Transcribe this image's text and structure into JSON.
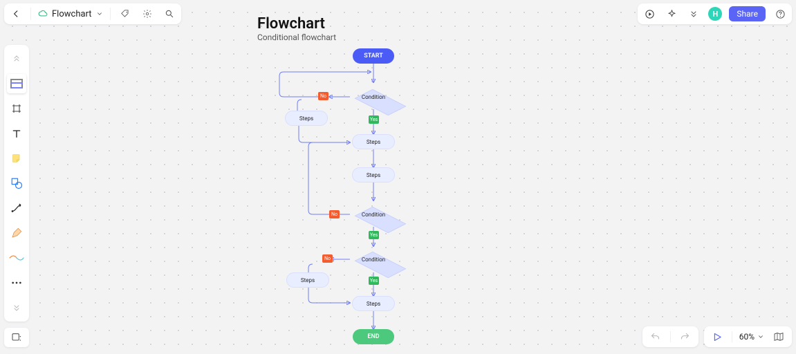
{
  "doc": {
    "title": "Flowchart"
  },
  "canvas": {
    "title": "Flowchart",
    "subtitle": "Conditional flowchart"
  },
  "toolbar_icons": {
    "back": "back-icon",
    "cloud": "cloud-icon",
    "chevron_title": "chevron-down-icon",
    "tag": "tag-icon",
    "gear": "gear-icon",
    "search": "search-icon",
    "play": "play-circle-icon",
    "sparkle": "sparkle-icon",
    "chevrons": "chevrons-down-icon",
    "help": "help-icon"
  },
  "share": {
    "label": "Share"
  },
  "avatar": {
    "initial": "H"
  },
  "tools": {
    "collapse": "chevrons-up-icon",
    "template": "template-icon",
    "frame": "frame-icon",
    "text": "text-icon",
    "sticky": "sticky-note-icon",
    "shape": "shape-icon",
    "connector": "connector-icon",
    "pen": "pen-icon",
    "highlighter": "highlighter-icon",
    "more": "more-icon",
    "expand": "chevrons-down-icon",
    "assets": "assets-icon"
  },
  "bottom": {
    "undo": "undo-icon",
    "redo": "redo-icon",
    "present": "present-icon",
    "zoom_label": "60%",
    "zoom_chevron": "chevron-down-icon",
    "map": "map-icon"
  },
  "nodes": {
    "start": "START",
    "end": "END",
    "condition1": "Condition",
    "condition2": "Condition",
    "condition3": "Condition",
    "steps_left1": "Steps",
    "steps_left2": "Steps",
    "steps_mid1": "Steps",
    "steps_mid2": "Steps",
    "steps_mid3": "Steps"
  },
  "labels": {
    "yes": "Yes",
    "no": "No"
  }
}
